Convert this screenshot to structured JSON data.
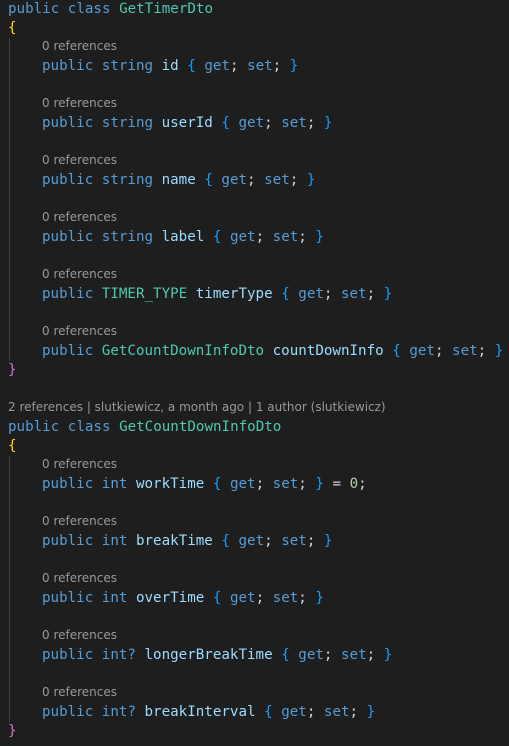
{
  "keywords": {
    "public": "public",
    "class": "class",
    "string": "string",
    "int": "int",
    "intq": "int?",
    "get": "get",
    "set": "set"
  },
  "punct": {
    "lbrace": "{",
    "rbrace": "}",
    "semi": ";",
    "eq": "="
  },
  "colors": {
    "background": "#1e1e1e",
    "keyword": "#569cd6",
    "type": "#4ec9b0",
    "property": "#9cdcfe",
    "class_brace": "#da70d6",
    "accessor_brace": "#179fff",
    "number": "#b5cea8",
    "codelens": "#999999"
  },
  "class1": {
    "name": "GetTimerDto",
    "members": [
      {
        "refs": "0 references",
        "type": "string",
        "name": "id"
      },
      {
        "refs": "0 references",
        "type": "string",
        "name": "userId"
      },
      {
        "refs": "0 references",
        "type": "string",
        "name": "name"
      },
      {
        "refs": "0 references",
        "type": "string",
        "name": "label"
      },
      {
        "refs": "0 references",
        "type": "TIMER_TYPE",
        "name": "timerType"
      },
      {
        "refs": "0 references",
        "type": "GetCountDownInfoDto",
        "name": "countDownInfo"
      }
    ]
  },
  "class2": {
    "codelens": "2 references | slutkiewicz, a month ago | 1 author (slutkiewicz)",
    "name": "GetCountDownInfoDto",
    "members": [
      {
        "refs": "0 references",
        "type": "int",
        "name": "workTime",
        "init": "0"
      },
      {
        "refs": "0 references",
        "type": "int",
        "name": "breakTime"
      },
      {
        "refs": "0 references",
        "type": "int",
        "name": "overTime"
      },
      {
        "refs": "0 references",
        "type": "int?",
        "name": "longerBreakTime"
      },
      {
        "refs": "0 references",
        "type": "int?",
        "name": "breakInterval"
      }
    ]
  }
}
